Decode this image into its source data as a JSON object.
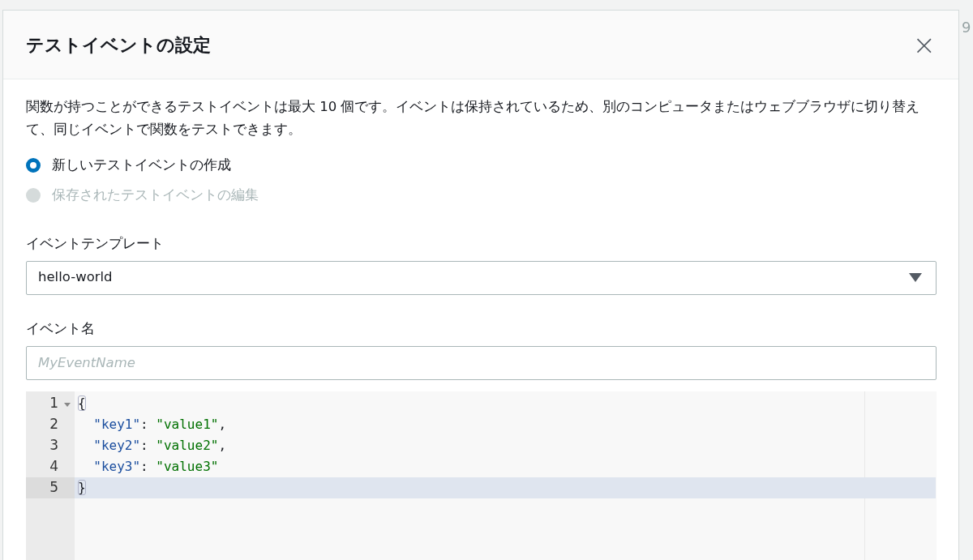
{
  "background": {
    "fragment": "9"
  },
  "dialog": {
    "title": "テストイベントの設定",
    "close": "×",
    "description": "関数が持つことができるテストイベントは最大 10 個です。イベントは保持されているため、別のコンピュータまたはウェブブラウザに切り替えて、同じイベントで関数をテストできます。",
    "options": [
      {
        "label": "新しいテストイベントの作成",
        "selected": true,
        "disabled": false
      },
      {
        "label": "保存されたテストイベントの編集",
        "selected": false,
        "disabled": true
      }
    ],
    "template": {
      "label": "イベントテンプレート",
      "value": "hello-world"
    },
    "event_name": {
      "label": "イベント名",
      "placeholder": "MyEventName"
    },
    "editor": {
      "lines": [
        {
          "number": "1",
          "foldable": true,
          "active": false,
          "tokens": [
            {
              "kind": "bracket",
              "text": "{"
            }
          ]
        },
        {
          "number": "2",
          "foldable": false,
          "active": false,
          "tokens": [
            {
              "kind": "key",
              "text": "  \"key1\""
            },
            {
              "kind": "punct",
              "text": ": "
            },
            {
              "kind": "string",
              "text": "\"value1\""
            },
            {
              "kind": "punct",
              "text": ","
            }
          ]
        },
        {
          "number": "3",
          "foldable": false,
          "active": false,
          "tokens": [
            {
              "kind": "key",
              "text": "  \"key2\""
            },
            {
              "kind": "punct",
              "text": ": "
            },
            {
              "kind": "string",
              "text": "\"value2\""
            },
            {
              "kind": "punct",
              "text": ","
            }
          ]
        },
        {
          "number": "4",
          "foldable": false,
          "active": false,
          "tokens": [
            {
              "kind": "key",
              "text": "  \"key3\""
            },
            {
              "kind": "punct",
              "text": ": "
            },
            {
              "kind": "string",
              "text": "\"value3\""
            }
          ]
        },
        {
          "number": "5",
          "foldable": false,
          "active": true,
          "tokens": [
            {
              "kind": "bracket",
              "text": "}"
            }
          ]
        }
      ]
    }
  }
}
